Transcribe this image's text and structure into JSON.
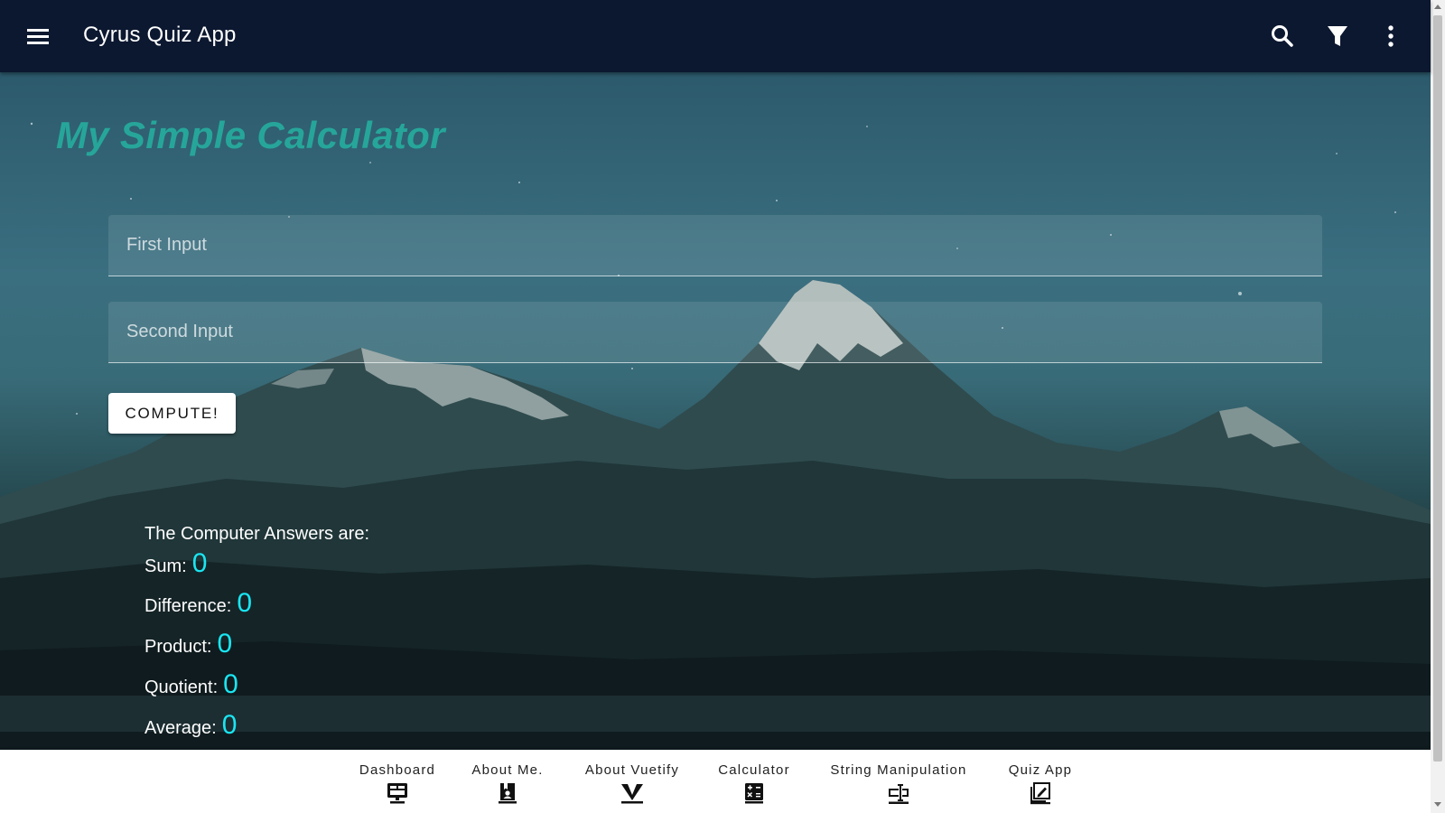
{
  "appbar": {
    "title": "Cyrus Quiz App",
    "icons": {
      "menu": "hamburger-menu-icon",
      "search": "search-icon",
      "filter": "filter-icon",
      "more": "more-vertical-icon"
    }
  },
  "main": {
    "heading": "My Simple Calculator",
    "first_input": {
      "placeholder": "First Input",
      "value": ""
    },
    "second_input": {
      "placeholder": "Second Input",
      "value": ""
    },
    "compute_label": "COMPUTE!",
    "results": {
      "intro": "The Computer Answers are:",
      "rows": [
        {
          "label": "Sum:",
          "value": "0"
        },
        {
          "label": "Difference:",
          "value": "0"
        },
        {
          "label": "Product:",
          "value": "0"
        },
        {
          "label": "Quotient:",
          "value": "0"
        },
        {
          "label": "Average:",
          "value": "0"
        }
      ]
    },
    "colors": {
      "heading": "#26a69a",
      "result_value": "#19e6f2",
      "appbar": "#0c1830"
    }
  },
  "bottom_nav": {
    "items": [
      {
        "label": "Dashboard",
        "icon": "monitor-dashboard-icon"
      },
      {
        "label": "About Me.",
        "icon": "book-account-icon"
      },
      {
        "label": "About Vuetify",
        "icon": "vuetify-icon"
      },
      {
        "label": "Calculator",
        "icon": "calculator-icon"
      },
      {
        "label": "String Manipulation",
        "icon": "form-textbox-icon"
      },
      {
        "label": "Quiz App",
        "icon": "chart-box-edit-icon"
      }
    ]
  }
}
